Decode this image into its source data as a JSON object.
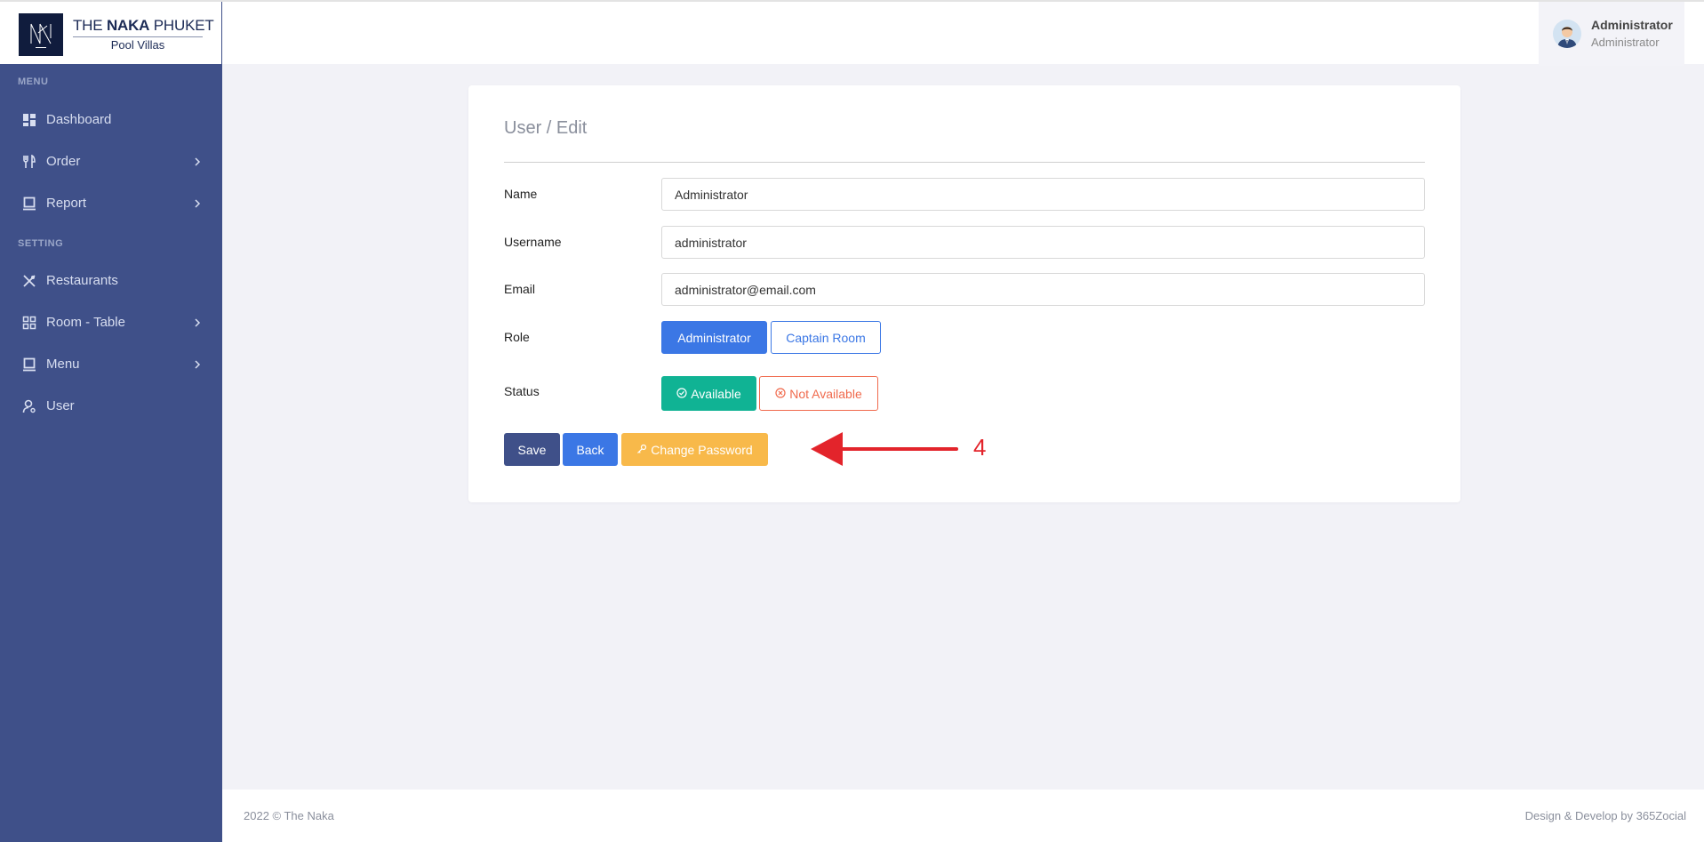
{
  "brand": {
    "title_prefix": "THE ",
    "title_bold": "NAKA",
    "title_suffix": " PHUKET",
    "subtitle": "Pool Villas"
  },
  "header": {
    "user_name": "Administrator",
    "user_role": "Administrator"
  },
  "sidebar": {
    "menu_heading": "MENU",
    "setting_heading": "SETTING",
    "items": [
      {
        "label": "Dashboard",
        "icon": "dashboard-icon",
        "has_submenu": false
      },
      {
        "label": "Order",
        "icon": "utensils-icon",
        "has_submenu": true
      },
      {
        "label": "Report",
        "icon": "report-icon",
        "has_submenu": true
      },
      {
        "label": "Restaurants",
        "icon": "restaurant-icon",
        "has_submenu": false
      },
      {
        "label": "Room - Table",
        "icon": "grid-icon",
        "has_submenu": true
      },
      {
        "label": "Menu",
        "icon": "menu-book-icon",
        "has_submenu": true
      },
      {
        "label": "User",
        "icon": "user-icon",
        "has_submenu": false
      }
    ]
  },
  "form": {
    "title": "User / Edit",
    "name_label": "Name",
    "name_value": "Administrator",
    "username_label": "Username",
    "username_value": "administrator",
    "email_label": "Email",
    "email_value": "administrator@email.com",
    "role_label": "Role",
    "role_options": [
      "Administrator",
      "Captain Room"
    ],
    "role_selected": "Administrator",
    "status_label": "Status",
    "status_options": [
      "Available",
      "Not Available"
    ],
    "status_selected": "Available",
    "save_label": "Save",
    "back_label": "Back",
    "change_password_label": "Change Password"
  },
  "annotation": {
    "number": "4"
  },
  "footer": {
    "left": "2022 © The Naka",
    "right": "Design & Develop by 365Zocial"
  },
  "colors": {
    "sidebar_bg": "#3f5089",
    "primary": "#3b77e5",
    "success": "#10b394",
    "danger": "#f06a4d",
    "warning": "#f8b94a",
    "annotation": "#e3242b"
  }
}
